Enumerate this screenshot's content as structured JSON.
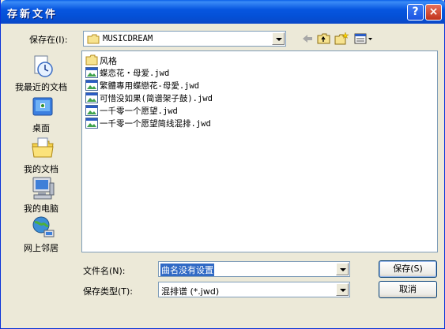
{
  "window": {
    "title": "存新文件",
    "help_glyph": "?",
    "close_glyph": "×"
  },
  "savein": {
    "label": "保存在(I):",
    "value": "MUSICDREAM"
  },
  "places": [
    {
      "label": "我最近的文档",
      "icon": "recent-documents-icon"
    },
    {
      "label": "桌面",
      "icon": "desktop-icon"
    },
    {
      "label": "我的文档",
      "icon": "my-documents-icon"
    },
    {
      "label": "我的电脑",
      "icon": "my-computer-icon"
    },
    {
      "label": "网上邻居",
      "icon": "network-places-icon"
    }
  ],
  "files": [
    {
      "name": "风格",
      "type": "folder"
    },
    {
      "name": "蝶恋花・母爱.jwd",
      "type": "jwd"
    },
    {
      "name": "繁體專用蝶戀花-母愛.jwd",
      "type": "jwd"
    },
    {
      "name": "可惜没如果(简谱架子鼓).jwd",
      "type": "jwd"
    },
    {
      "name": "一千零一个愿望.jwd",
      "type": "jwd"
    },
    {
      "name": "一千零一个愿望简线混排.jwd",
      "type": "jwd"
    }
  ],
  "filename": {
    "label": "文件名(N):",
    "value": "曲名没有设置"
  },
  "filetype": {
    "label": "保存类型(T):",
    "value": "混排谱 (*.jwd)"
  },
  "buttons": {
    "save": "保存(S)",
    "cancel": "取消"
  },
  "colors": {
    "title_bar": "#0450d6",
    "selection": "#316ac5",
    "dialog_bg": "#ece9d8"
  }
}
